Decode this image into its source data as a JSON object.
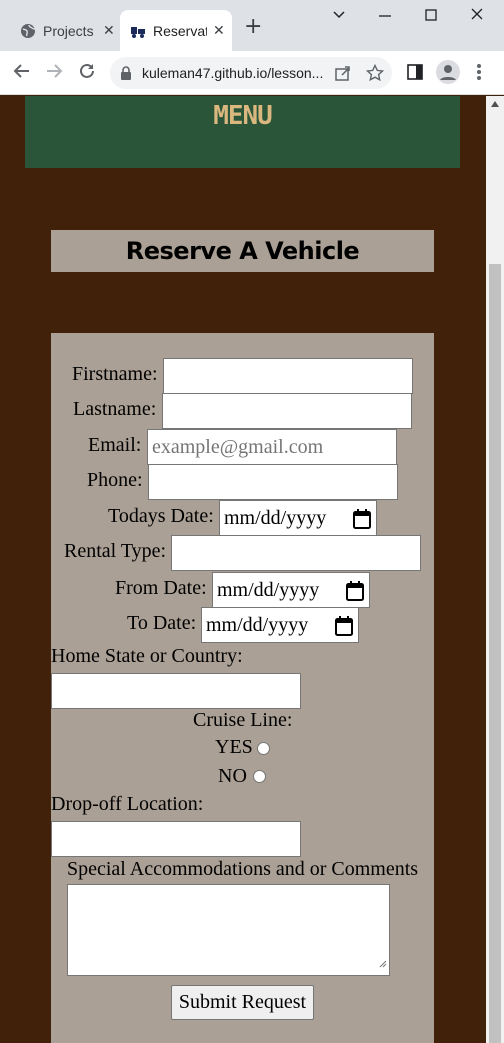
{
  "browser": {
    "tabs": [
      {
        "title": "Projects",
        "active": false
      },
      {
        "title": "Reservat",
        "active": true
      }
    ],
    "url": "kuleman47.github.io/lesson...",
    "controls": {
      "minimize": "—",
      "maximize": "☐",
      "close": "✕",
      "new_tab": "+"
    }
  },
  "page": {
    "menu_label": "MENU",
    "heading": "Reserve A Vehicle"
  },
  "form": {
    "firstname_label": "Firstname:",
    "lastname_label": "Lastname:",
    "email_label": "Email:",
    "email_placeholder": "example@gmail.com",
    "phone_label": "Phone:",
    "todays_date_label": "Todays Date:",
    "date_placeholder": "mm/dd/yyyy",
    "rental_type_label": "Rental Type:",
    "from_date_label": "From Date:",
    "to_date_label": "To Date:",
    "home_state_label": "Home State or Country:",
    "cruise_line_label": "Cruise Line:",
    "yes_label": "YES",
    "no_label": "NO",
    "dropoff_label": "Drop-off Location:",
    "comments_label": "Special Accommodations and or Comments",
    "submit_label": "Submit Request"
  },
  "colors": {
    "page_bg": "#42210b",
    "menu_bg": "#2a5538",
    "menu_text": "#d9b77e",
    "panel_bg": "#aba095"
  }
}
